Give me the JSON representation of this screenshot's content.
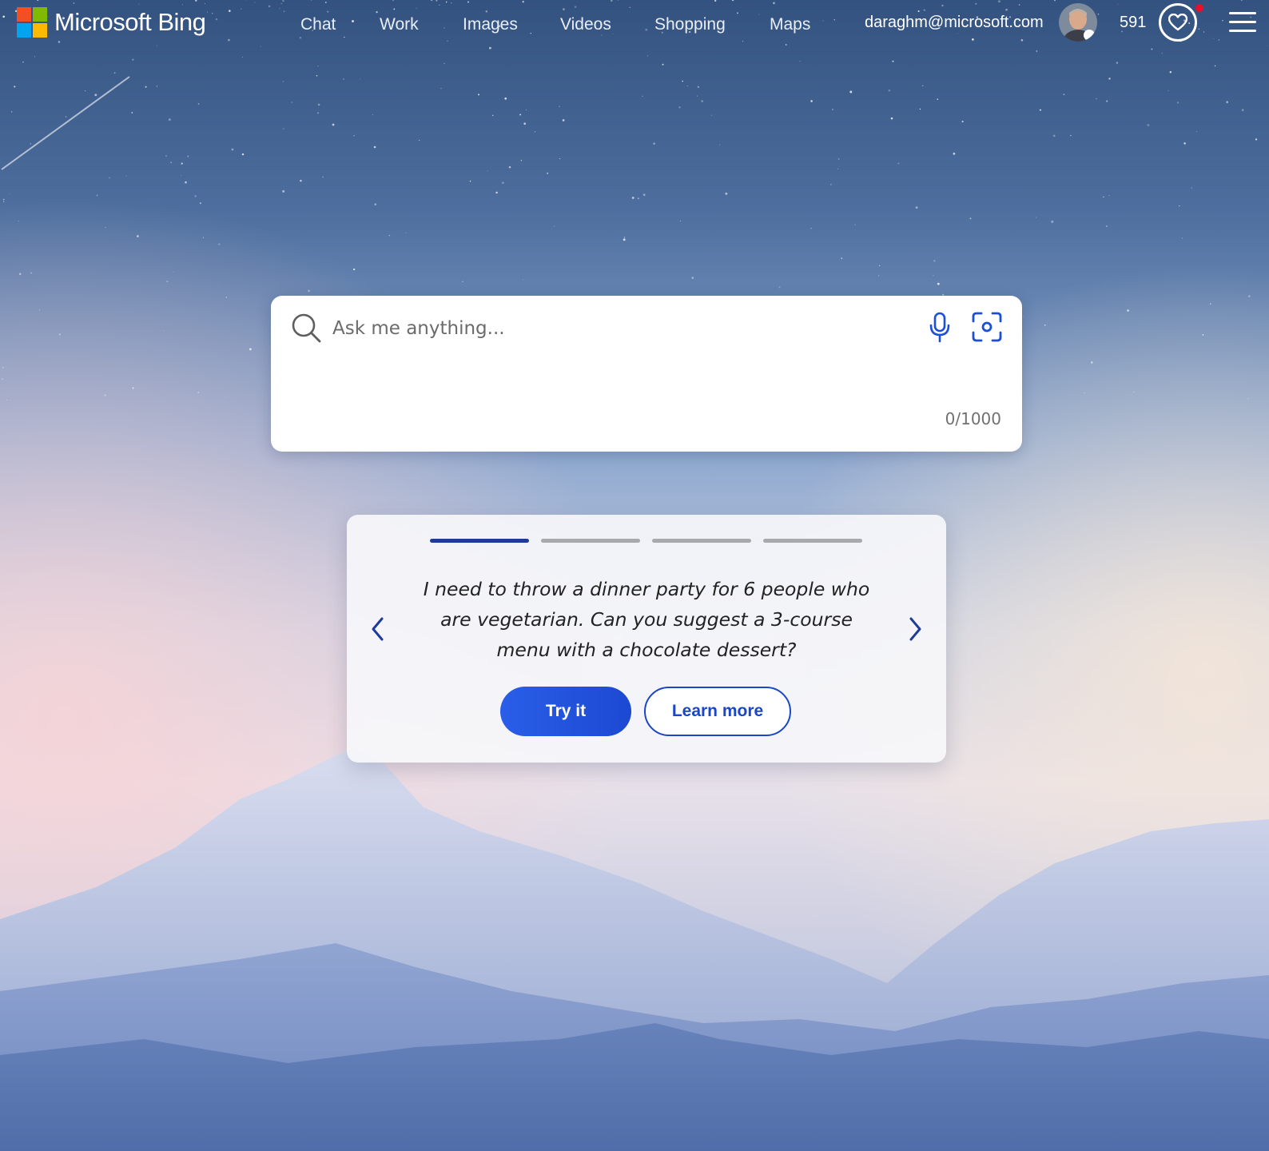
{
  "header": {
    "brand": "Microsoft Bing",
    "nav": [
      "Chat",
      "Work",
      "Images",
      "Videos",
      "Shopping",
      "Maps"
    ],
    "account_email": "daraghm@microsoft.com",
    "reward_points": "591"
  },
  "search": {
    "placeholder": "Ask me anything...",
    "value": "",
    "char_count": "0/1000"
  },
  "carousel": {
    "slide_count": 4,
    "active_slide": 1,
    "prompt": "I need to throw a dinner party for 6 people who are vegetarian. Can you suggest a 3-course menu with a chocolate dessert?",
    "try_label": "Try it",
    "learn_label": "Learn more"
  },
  "icons": {
    "logo": "microsoft-logo",
    "search": "search-icon",
    "mic": "microphone-icon",
    "visual_search": "visual-search-icon",
    "rewards": "heart-icon",
    "menu": "hamburger-menu-icon",
    "prev": "chevron-left-icon",
    "next": "chevron-right-icon"
  },
  "colors": {
    "accent": "#1e3a9a",
    "button": "#2057e0",
    "logo": [
      "#f25022",
      "#7fba00",
      "#00a4ef",
      "#ffb900"
    ]
  }
}
